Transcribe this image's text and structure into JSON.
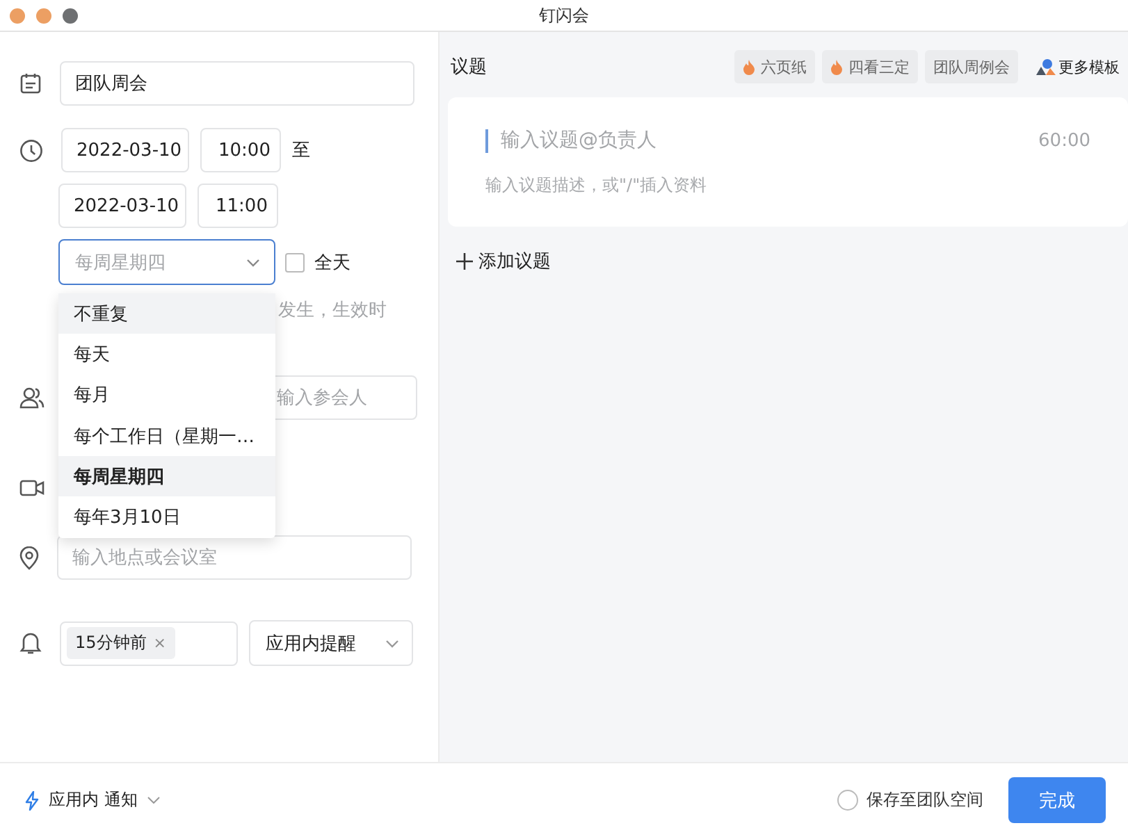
{
  "window": {
    "title": "钉闪会"
  },
  "form": {
    "title": {
      "value": "团队周会"
    },
    "start": {
      "date": "2022-03-10",
      "time": "10:00"
    },
    "to_label": "至",
    "end": {
      "date": "2022-03-10",
      "time": "11:00"
    },
    "repeat": {
      "placeholder": "每周星期四",
      "expanded": true
    },
    "all_day": {
      "label": "全天",
      "checked": false
    },
    "repeat_hint": "发生，生效时",
    "attendees": {
      "placeholder": "输入参会人"
    },
    "location": {
      "placeholder": "输入地点或会议室"
    },
    "reminder": {
      "tag": "15分钟前",
      "tag_remove": "×",
      "channel": "应用内提醒"
    }
  },
  "repeat_menu": [
    {
      "label": "不重复",
      "selected": false,
      "hovered": true
    },
    {
      "label": "每天",
      "selected": false,
      "hovered": false
    },
    {
      "label": "每月",
      "selected": false,
      "hovered": false
    },
    {
      "label": "每个工作日（星期一…",
      "selected": false,
      "hovered": false
    },
    {
      "label": "每周星期四",
      "selected": true,
      "hovered": false
    },
    {
      "label": "每年3月10日",
      "selected": false,
      "hovered": false
    }
  ],
  "agenda": {
    "label": "议题",
    "templates": [
      {
        "label": "六页纸",
        "kind": "hot"
      },
      {
        "label": "四看三定",
        "kind": "hot"
      },
      {
        "label": "团队周例会",
        "kind": "plain"
      },
      {
        "label": "更多模板",
        "kind": "more"
      }
    ],
    "item": {
      "title_placeholder": "输入议题@负责人",
      "duration": "60:00",
      "desc_placeholder": "输入议题描述，或\"/\"插入资料"
    },
    "add": "添加议题"
  },
  "footer": {
    "notify": "应用内 通知",
    "save_to_team": {
      "label": "保存至团队空间",
      "checked": false
    },
    "done": "完成"
  }
}
